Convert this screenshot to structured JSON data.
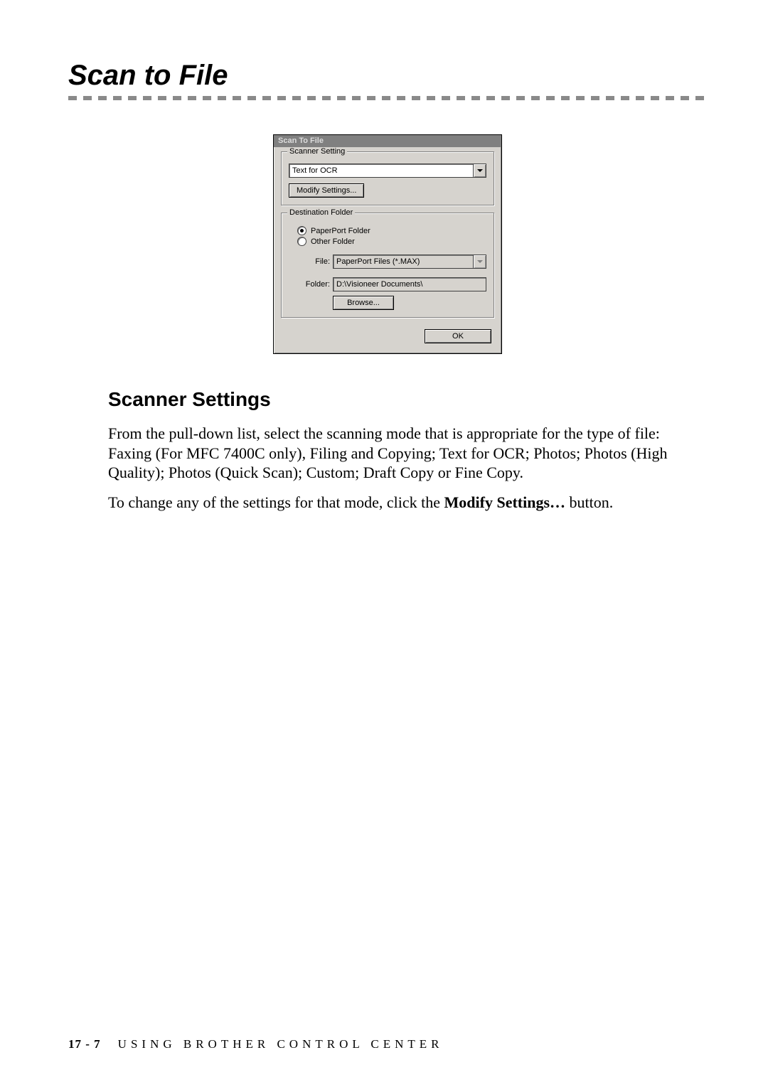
{
  "heading": "Scan to File",
  "dialog": {
    "title": "Scan To File",
    "scanner_setting": {
      "legend": "Scanner Setting",
      "mode": "Text for OCR",
      "modify_btn": "Modify Settings..."
    },
    "destination": {
      "legend": "Destination Folder",
      "radio_paperport": "PaperPort Folder",
      "radio_other": "Other Folder",
      "file_label": "File:",
      "file_value": "PaperPort Files (*.MAX)",
      "folder_label": "Folder:",
      "folder_value": "D:\\Visioneer Documents\\",
      "browse_btn": "Browse..."
    },
    "ok_btn": "OK"
  },
  "sub_heading": "Scanner Settings",
  "para1": "From the pull-down list, select the scanning mode that is appropriate for the type of file:  Faxing (For MFC 7400C only), Filing and Copying; Text for OCR; Photos; Photos (High Quality); Photos (Quick Scan); Custom; Draft Copy or Fine Copy.",
  "para2_pre": "To change any of the settings for that mode, click the ",
  "para2_bold": "Modify Settings…",
  "para2_post": " button.",
  "footer": {
    "page": "17 - 7",
    "section": "USING BROTHER CONTROL CENTER"
  }
}
